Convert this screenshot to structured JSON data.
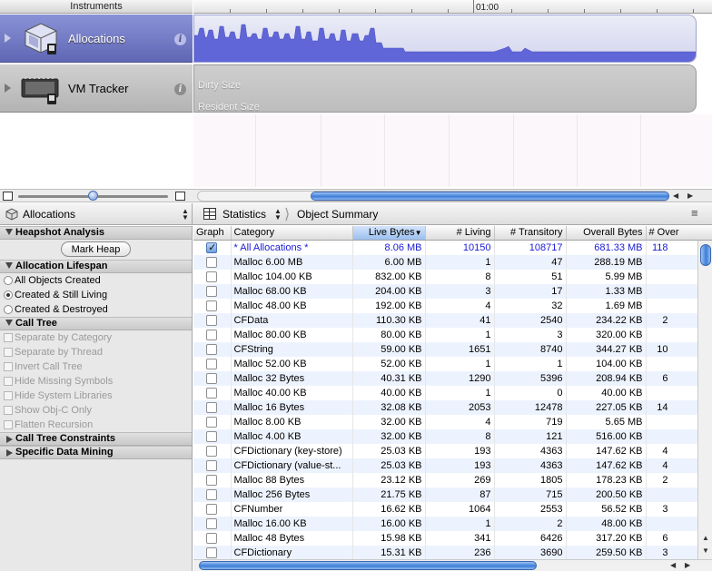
{
  "instruments": {
    "header": "Instruments",
    "ruler_label": "01:00",
    "items": [
      {
        "name": "Allocations",
        "icon": "allocations-instrument-icon"
      },
      {
        "name": "VM Tracker",
        "icon": "vm-tracker-instrument-icon"
      }
    ],
    "vm_tracks": [
      "Dirty Size",
      "Resident Size"
    ]
  },
  "nav": {
    "instrument": "Allocations",
    "view": "Statistics",
    "breadcrumb": "Object Summary"
  },
  "left_panel": {
    "heapshot": {
      "title": "Heapshot Analysis",
      "button": "Mark Heap"
    },
    "lifespan": {
      "title": "Allocation Lifespan",
      "options": [
        {
          "label": "All Objects Created",
          "selected": false
        },
        {
          "label": "Created & Still Living",
          "selected": true
        },
        {
          "label": "Created & Destroyed",
          "selected": false
        }
      ]
    },
    "call_tree": {
      "title": "Call Tree",
      "options": [
        "Separate by Category",
        "Separate by Thread",
        "Invert Call Tree",
        "Hide Missing Symbols",
        "Hide System Libraries",
        "Show Obj-C Only",
        "Flatten Recursion"
      ]
    },
    "constraints": {
      "title": "Call Tree Constraints"
    },
    "data_mining": {
      "title": "Specific Data Mining"
    }
  },
  "table": {
    "columns": [
      "Graph",
      "Category",
      "Live Bytes",
      "# Living",
      "# Transitory",
      "Overall Bytes",
      "# Over"
    ],
    "sorted_column": 2,
    "rows": [
      {
        "checked": true,
        "category": "* All Allocations *",
        "live": "8.06 MB",
        "living": "10150",
        "transitory": "108717",
        "overall": "681.33 MB",
        "over": "118"
      },
      {
        "checked": false,
        "category": "Malloc 6.00 MB",
        "live": "6.00 MB",
        "living": "1",
        "transitory": "47",
        "overall": "288.19 MB",
        "over": ""
      },
      {
        "checked": false,
        "category": "Malloc 104.00 KB",
        "live": "832.00 KB",
        "living": "8",
        "transitory": "51",
        "overall": "5.99 MB",
        "over": ""
      },
      {
        "checked": false,
        "category": "Malloc 68.00 KB",
        "live": "204.00 KB",
        "living": "3",
        "transitory": "17",
        "overall": "1.33 MB",
        "over": ""
      },
      {
        "checked": false,
        "category": "Malloc 48.00 KB",
        "live": "192.00 KB",
        "living": "4",
        "transitory": "32",
        "overall": "1.69 MB",
        "over": ""
      },
      {
        "checked": false,
        "category": "CFData",
        "live": "110.30 KB",
        "living": "41",
        "transitory": "2540",
        "overall": "234.22 KB",
        "over": "2"
      },
      {
        "checked": false,
        "category": "Malloc 80.00 KB",
        "live": "80.00 KB",
        "living": "1",
        "transitory": "3",
        "overall": "320.00 KB",
        "over": ""
      },
      {
        "checked": false,
        "category": "CFString",
        "live": "59.00 KB",
        "living": "1651",
        "transitory": "8740",
        "overall": "344.27 KB",
        "over": "10"
      },
      {
        "checked": false,
        "category": "Malloc 52.00 KB",
        "live": "52.00 KB",
        "living": "1",
        "transitory": "1",
        "overall": "104.00 KB",
        "over": ""
      },
      {
        "checked": false,
        "category": "Malloc 32 Bytes",
        "live": "40.31 KB",
        "living": "1290",
        "transitory": "5396",
        "overall": "208.94 KB",
        "over": "6"
      },
      {
        "checked": false,
        "category": "Malloc 40.00 KB",
        "live": "40.00 KB",
        "living": "1",
        "transitory": "0",
        "overall": "40.00 KB",
        "over": ""
      },
      {
        "checked": false,
        "category": "Malloc 16 Bytes",
        "live": "32.08 KB",
        "living": "2053",
        "transitory": "12478",
        "overall": "227.05 KB",
        "over": "14"
      },
      {
        "checked": false,
        "category": "Malloc 8.00 KB",
        "live": "32.00 KB",
        "living": "4",
        "transitory": "719",
        "overall": "5.65 MB",
        "over": ""
      },
      {
        "checked": false,
        "category": "Malloc 4.00 KB",
        "live": "32.00 KB",
        "living": "8",
        "transitory": "121",
        "overall": "516.00 KB",
        "over": ""
      },
      {
        "checked": false,
        "category": "CFDictionary (key-store)",
        "live": "25.03 KB",
        "living": "193",
        "transitory": "4363",
        "overall": "147.62 KB",
        "over": "4"
      },
      {
        "checked": false,
        "category": "CFDictionary (value-st...",
        "live": "25.03 KB",
        "living": "193",
        "transitory": "4363",
        "overall": "147.62 KB",
        "over": "4"
      },
      {
        "checked": false,
        "category": "Malloc 88 Bytes",
        "live": "23.12 KB",
        "living": "269",
        "transitory": "1805",
        "overall": "178.23 KB",
        "over": "2"
      },
      {
        "checked": false,
        "category": "Malloc 256 Bytes",
        "live": "21.75 KB",
        "living": "87",
        "transitory": "715",
        "overall": "200.50 KB",
        "over": ""
      },
      {
        "checked": false,
        "category": "CFNumber",
        "live": "16.62 KB",
        "living": "1064",
        "transitory": "2553",
        "overall": "56.52 KB",
        "over": "3"
      },
      {
        "checked": false,
        "category": "Malloc 16.00 KB",
        "live": "16.00 KB",
        "living": "1",
        "transitory": "2",
        "overall": "48.00 KB",
        "over": ""
      },
      {
        "checked": false,
        "category": "Malloc 48 Bytes",
        "live": "15.98 KB",
        "living": "341",
        "transitory": "6426",
        "overall": "317.20 KB",
        "over": "6"
      },
      {
        "checked": false,
        "category": "CFDictionary",
        "live": "15.31 KB",
        "living": "236",
        "transitory": "3690",
        "overall": "259.50 KB",
        "over": "3"
      }
    ]
  },
  "colors": {
    "allocations_accent": "#6a72c8",
    "graph_fill": "#6066d8",
    "selection": "#3d7ed8"
  }
}
